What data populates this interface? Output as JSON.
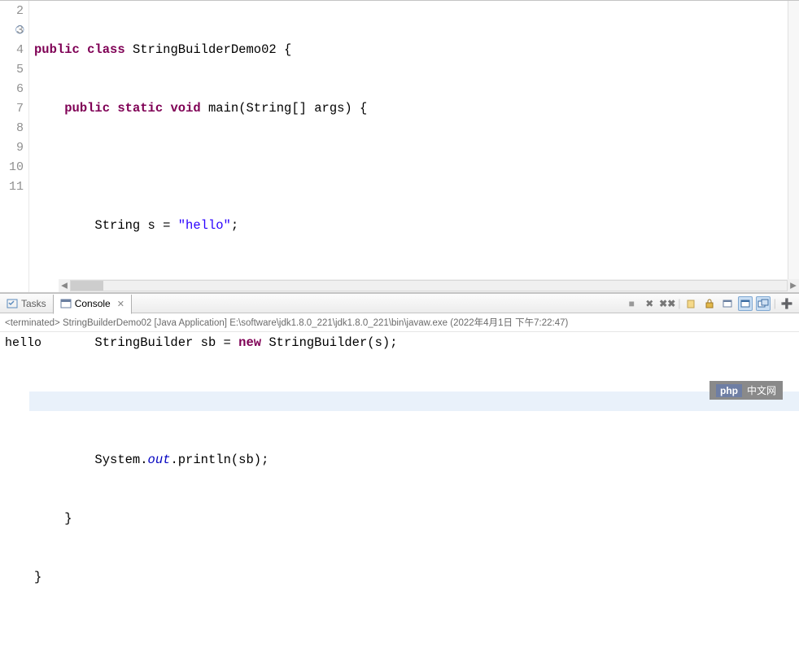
{
  "code": {
    "lines": [
      {
        "n": "2",
        "marker": false
      },
      {
        "n": "3",
        "marker": true
      },
      {
        "n": "4",
        "marker": false
      },
      {
        "n": "5",
        "marker": false
      },
      {
        "n": "6",
        "marker": false
      },
      {
        "n": "7",
        "marker": false
      },
      {
        "n": "8",
        "marker": false
      },
      {
        "n": "9",
        "marker": false
      },
      {
        "n": "10",
        "marker": false
      },
      {
        "n": "11",
        "marker": false
      }
    ],
    "tokens": {
      "public": "public",
      "class_kw": "class",
      "class_name": "StringBuilderDemo02",
      "static_kw": "static",
      "void_kw": "void",
      "main": "main(String[] args) {",
      "string_type": "String s = ",
      "string_lit": "\"hello\"",
      "sb_left": "StringBuilder sb = ",
      "new_kw": "new",
      "sb_right": " StringBuilder(s);",
      "sys": "System.",
      "out": "out",
      "println": ".println(sb);"
    }
  },
  "tabs": {
    "tasks": "Tasks",
    "console": "Console"
  },
  "console": {
    "header_prefix": "<terminated>",
    "header_app": "StringBuilderDemo02 [Java Application]",
    "header_path": "E:\\software\\jdk1.8.0_221\\jdk1.8.0_221\\bin\\javaw.exe",
    "header_time": "(2022年4月1日 下午7:22:47)",
    "output": "hello"
  },
  "watermark": {
    "php": "php",
    "cn": "中文网"
  }
}
